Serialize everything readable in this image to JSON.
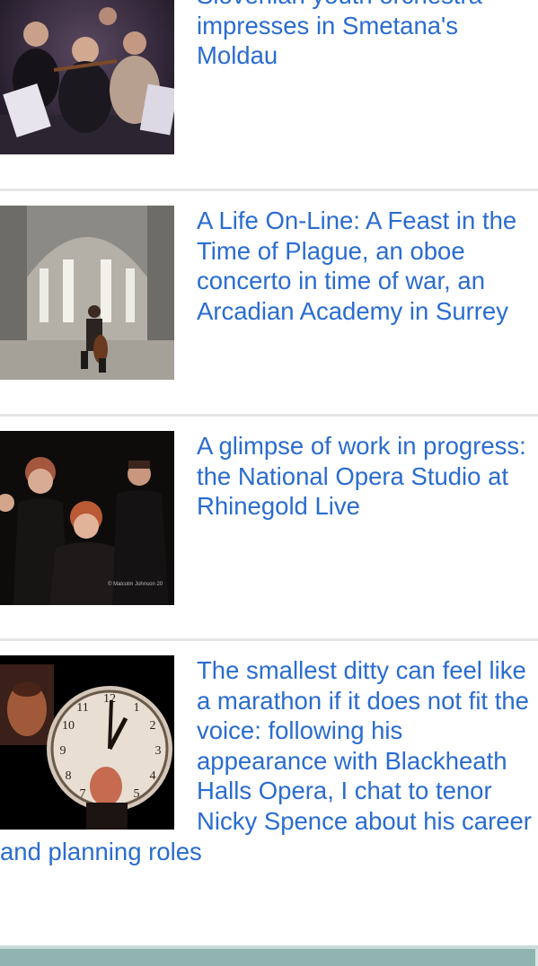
{
  "articles": [
    {
      "title": "Slovenian youth orchestra impresses in Smetana's Moldau",
      "image": "orchestra-photo"
    },
    {
      "title": "A Life On-Line: A Feast in the Time of Plague, an oboe concerto in time of war, an Arcadian Academy in Surrey",
      "image": "cellist-ruined-church-photo"
    },
    {
      "title": "A glimpse of work in progress: the National Opera Studio at Rhinegold Live",
      "image": "singers-photo",
      "image_caption": "© Malcolm Johnson 20"
    },
    {
      "title": "The smallest ditty can feel like a marathon if it does not fit the voice: following his appearance with Blackheath Halls Opera, I chat to tenor Nicky Spence about his career and planning roles",
      "image": "clock-tenor-photo"
    }
  ]
}
